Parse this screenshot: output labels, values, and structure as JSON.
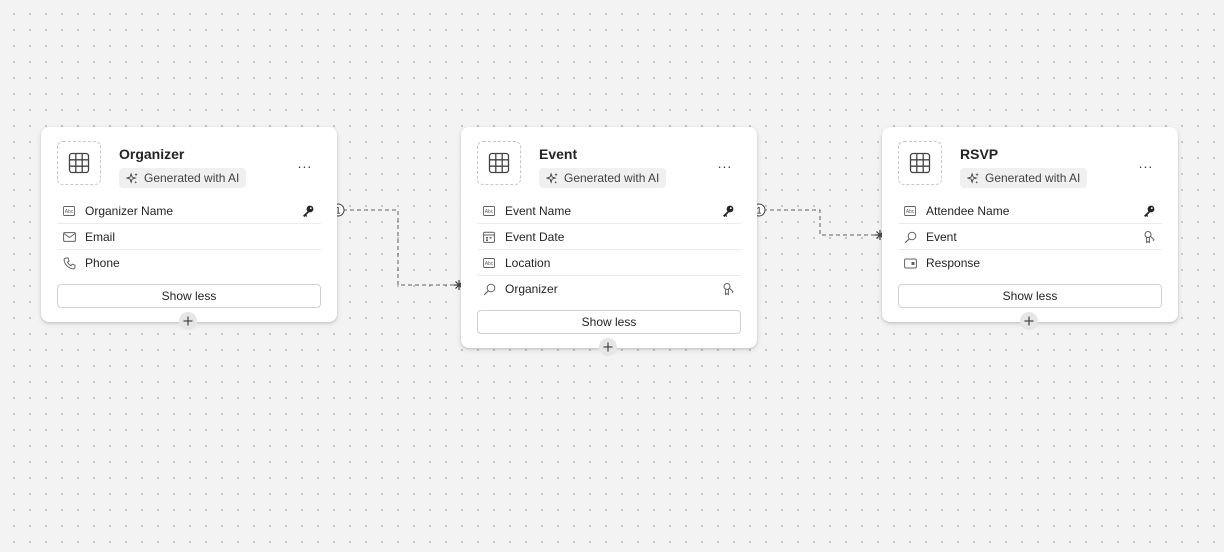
{
  "tables": [
    {
      "title": "Organizer",
      "badge": "Generated with AI",
      "more": "...",
      "fields": [
        {
          "label": "Organizer Name",
          "icon": "text-field-icon",
          "badge": "primary-key-icon"
        },
        {
          "label": "Email",
          "icon": "email-icon"
        },
        {
          "label": "Phone",
          "icon": "phone-icon"
        }
      ],
      "show_less": "Show less"
    },
    {
      "title": "Event",
      "badge": "Generated with AI",
      "more": "...",
      "fields": [
        {
          "label": "Event Name",
          "icon": "text-field-icon",
          "badge": "primary-key-icon"
        },
        {
          "label": "Event Date",
          "icon": "calendar-icon"
        },
        {
          "label": "Location",
          "icon": "text-field-icon"
        },
        {
          "label": "Organizer",
          "icon": "lookup-icon",
          "badge": "foreign-key-icon"
        }
      ],
      "show_less": "Show less"
    },
    {
      "title": "RSVP",
      "badge": "Generated with AI",
      "more": "...",
      "fields": [
        {
          "label": "Attendee Name",
          "icon": "text-field-icon",
          "badge": "primary-key-icon"
        },
        {
          "label": "Event",
          "icon": "lookup-icon",
          "badge": "foreign-key-icon"
        },
        {
          "label": "Response",
          "icon": "choice-icon"
        }
      ],
      "show_less": "Show less"
    }
  ],
  "relationships": [
    {
      "from": "Organizer.Organizer Name",
      "to": "Event.Organizer",
      "one": "1",
      "many": "*"
    },
    {
      "from": "Event.Event Name",
      "to": "RSVP.Event",
      "one": "1",
      "many": "*"
    }
  ]
}
